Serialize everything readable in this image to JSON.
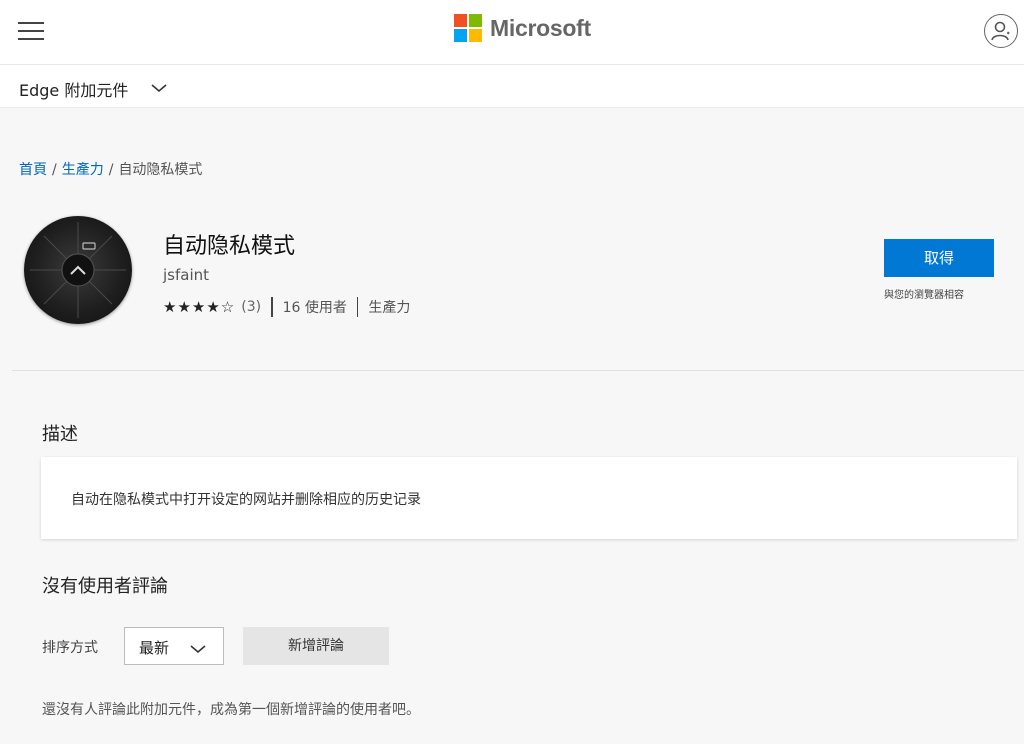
{
  "header": {
    "brand": "Microsoft",
    "brand_colors": [
      "#f25022",
      "#7fba00",
      "#00a4ef",
      "#ffb900"
    ],
    "menu_icon": "hamburger-icon",
    "account_icon": "account-icon"
  },
  "subnav": {
    "title": "Edge 附加元件",
    "chevron_icon": "chevron-down-icon"
  },
  "breadcrumb": {
    "home": "首頁",
    "sep1": "/",
    "category": "生產力",
    "sep2": "/",
    "current": "自动隐私模式"
  },
  "extension": {
    "name": "自动隐私模式",
    "author": "jsfaint",
    "stars_display": "★★★★☆",
    "rating": 4.5,
    "rating_count": "(3)",
    "users": "16 使用者",
    "category": "生產力",
    "get_label": "取得",
    "compat_note": "與您的瀏覽器相容",
    "accent": "#0078d4"
  },
  "description": {
    "heading": "描述",
    "text": "自动在隐私模式中打开设定的网站并删除相应的历史记录"
  },
  "reviews": {
    "heading": "沒有使用者評論",
    "sort_label": "排序方式",
    "sort_value": "最新",
    "add_label": "新增評論",
    "empty_text": "還沒有人評論此附加元件，成為第一個新增評論的使用者吧。"
  }
}
